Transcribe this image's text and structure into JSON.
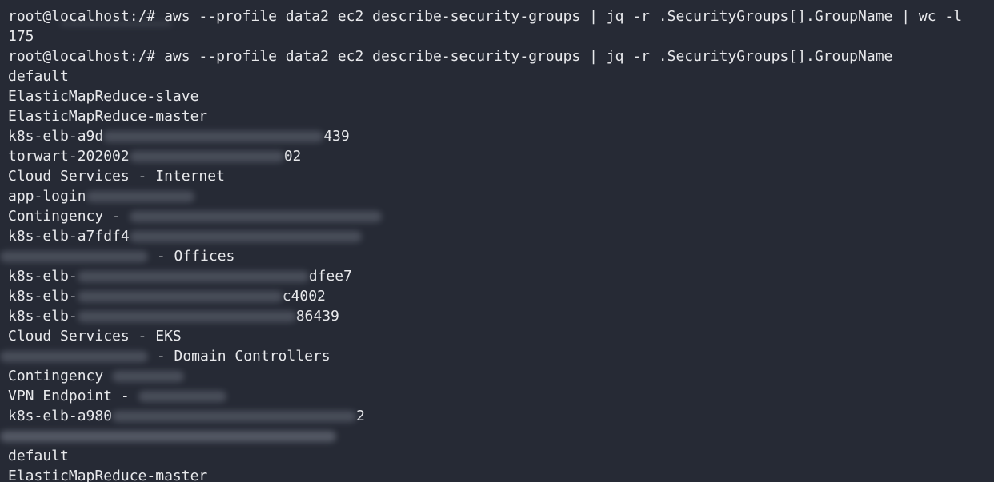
{
  "terminal": {
    "lines": [
      "root@localhost:/# aws --profile data2 ec2 describe-security-groups | jq -r .SecurityGroups[].GroupName | wc -l",
      "175",
      "root@localhost:/# aws --profile data2 ec2 describe-security-groups | jq -r .SecurityGroups[].GroupName",
      "default",
      "ElasticMapReduce-slave",
      "ElasticMapReduce-master"
    ],
    "k8s_a9d": {
      "prefix": "k8s-elb-a9d",
      "suffix": "439"
    },
    "torwart": {
      "prefix": "torwart-202002",
      "suffix": "02"
    },
    "cloud_internet": "Cloud Services - Internet",
    "app_login": {
      "prefix": "app-login"
    },
    "contingency_1": {
      "prefix": "Contingency -"
    },
    "k8s_a7fdf4": {
      "prefix": "k8s-elb-a7fdf4"
    },
    "offices": {
      "suffix": " - Offices"
    },
    "k8s_dfee7": {
      "prefix": "k8s-elb-",
      "suffix": "dfee7"
    },
    "k8s_c4002": {
      "prefix": "k8s-elb-",
      "suffix": "c4002"
    },
    "k8s_86439": {
      "prefix": "k8s-elb-",
      "suffix": "86439"
    },
    "cloud_eks": "Cloud Services - EKS",
    "domain_controllers": {
      "suffix": " - Domain Controllers"
    },
    "contingency_2": {
      "prefix": "Contingency"
    },
    "vpn": {
      "prefix": "VPN Endpoint -"
    },
    "k8s_a980": {
      "prefix": "k8s-elb-a980",
      "suffix": "2"
    },
    "tail": [
      "default",
      "ElasticMapReduce-master"
    ]
  }
}
